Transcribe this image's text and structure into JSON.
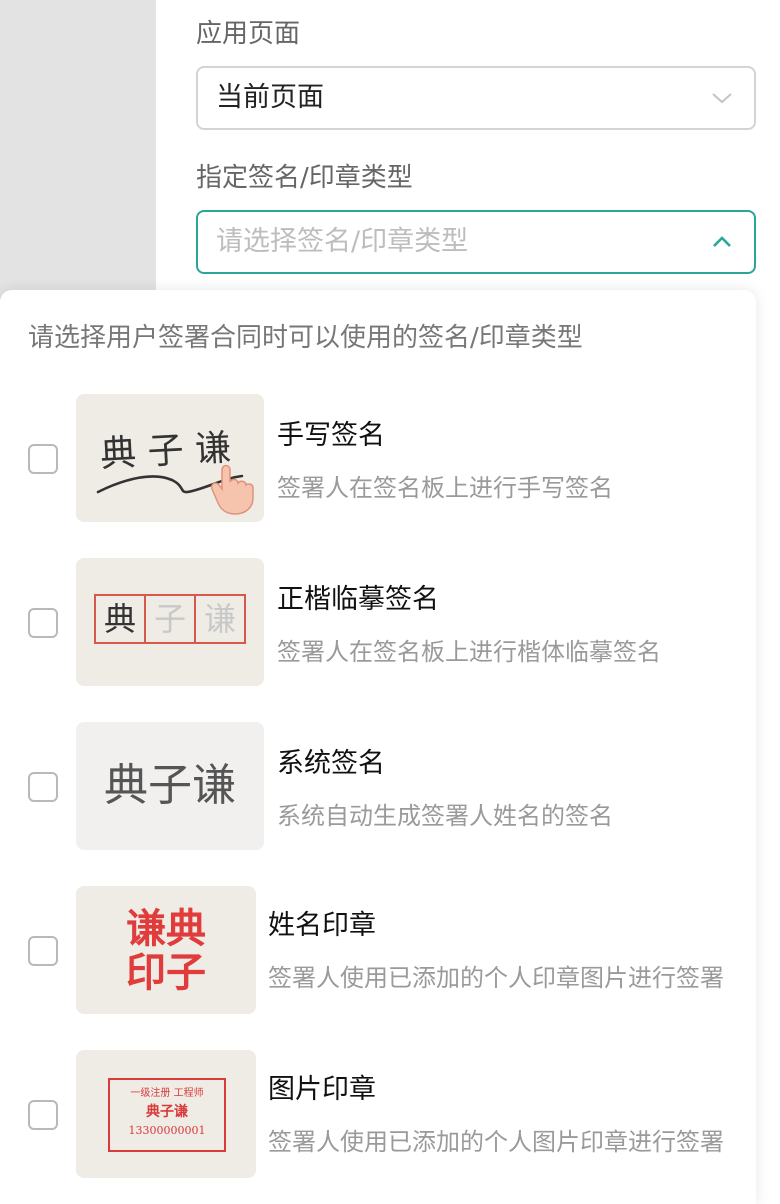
{
  "form": {
    "apply_page_label": "应用页面",
    "apply_page_value": "当前页面",
    "sign_type_label": "指定签名/印章类型",
    "sign_type_placeholder": "请选择签名/印章类型"
  },
  "dropdown": {
    "hint": "请选择用户签署合同时可以使用的签名/印章类型",
    "options": [
      {
        "title": "手写签名",
        "desc": "签署人在签名板上进行手写签名",
        "sample": "典 子 谦",
        "checked": false
      },
      {
        "title": "正楷临摹签名",
        "desc": "签署人在签名板上进行楷体临摹签名",
        "sample": [
          "典",
          "子",
          "谦"
        ],
        "checked": false
      },
      {
        "title": "系统签名",
        "desc": "系统自动生成签署人姓名的签名",
        "sample": "典子谦",
        "checked": false
      },
      {
        "title": "姓名印章",
        "desc": "签署人使用已添加的个人印章图片进行签署",
        "sample": [
          "谦典",
          "印子"
        ],
        "checked": false
      },
      {
        "title": "图片印章",
        "desc": "签署人使用已添加的个人图片印章进行签署",
        "sample": [
          "一级注册 工程师",
          "典子谦",
          "13300000001"
        ],
        "checked": false
      }
    ]
  },
  "colors": {
    "accent": "#2aa698",
    "seal_red": "#d93a3a"
  }
}
